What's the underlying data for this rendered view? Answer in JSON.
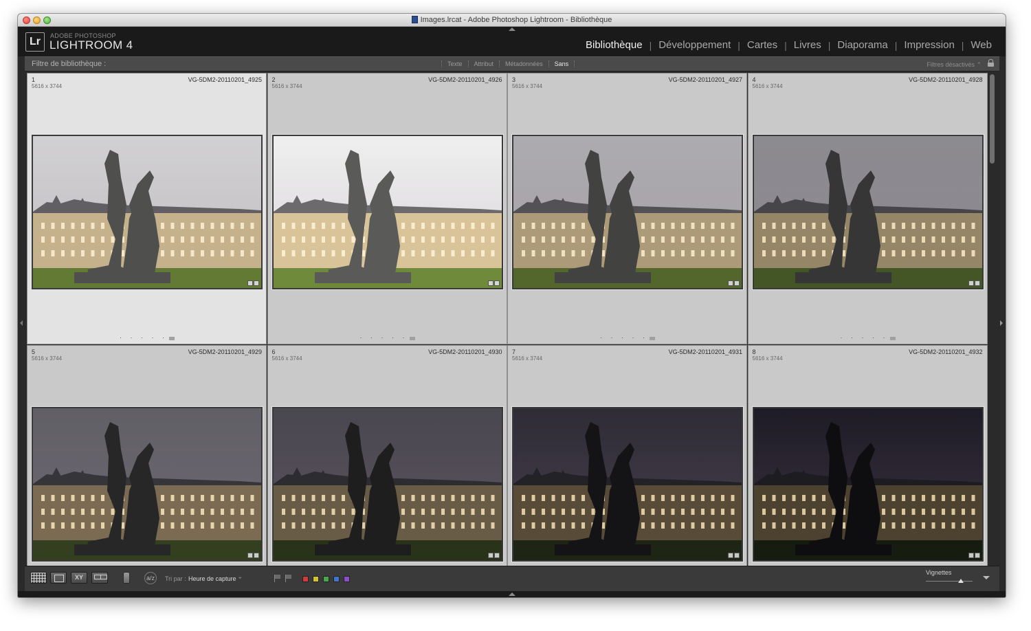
{
  "window": {
    "title": "Images.lrcat - Adobe Photoshop Lightroom - Bibliothèque"
  },
  "header": {
    "product": "ADOBE PHOTOSHOP",
    "version": "LIGHTROOM 4",
    "logo": "Lr",
    "modules": [
      {
        "label": "Bibliothèque",
        "active": true
      },
      {
        "label": "Développement",
        "active": false
      },
      {
        "label": "Cartes",
        "active": false
      },
      {
        "label": "Livres",
        "active": false
      },
      {
        "label": "Diaporama",
        "active": false
      },
      {
        "label": "Impression",
        "active": false
      },
      {
        "label": "Web",
        "active": false
      }
    ],
    "module_separator": "|"
  },
  "filter_bar": {
    "label": "Filtre de bibliothèque :",
    "tabs": [
      {
        "label": "Texte",
        "active": false
      },
      {
        "label": "Attribut",
        "active": false
      },
      {
        "label": "Métadonnées",
        "active": false
      },
      {
        "label": "Sans",
        "active": true
      }
    ],
    "status": "Filtres désactivés",
    "status_chevron": "⌃"
  },
  "grid": {
    "cells": [
      {
        "index": "1",
        "dims": "5616 x 3744",
        "filename": "VG-5DM2-20110201_4925",
        "exposure": 1.0,
        "rating_dots": "· · · · ·",
        "bg": "#e3e3e3"
      },
      {
        "index": "2",
        "dims": "5616 x 3744",
        "filename": "VG-5DM2-20110201_4926",
        "exposure": 1.15,
        "rating_dots": "· · · · ·",
        "bg": "#c9c9c9"
      },
      {
        "index": "3",
        "dims": "5616 x 3744",
        "filename": "VG-5DM2-20110201_4927",
        "exposure": 0.82,
        "rating_dots": "· · · · ·",
        "bg": "#c9c9c9"
      },
      {
        "index": "4",
        "dims": "5616 x 3744",
        "filename": "VG-5DM2-20110201_4928",
        "exposure": 0.66,
        "rating_dots": "· · · · ·",
        "bg": "#c9c9c9"
      },
      {
        "index": "5",
        "dims": "5616 x 3744",
        "filename": "VG-5DM2-20110201_4929",
        "exposure": 0.45,
        "rating_dots": "",
        "bg": "#c9c9c9"
      },
      {
        "index": "6",
        "dims": "5616 x 3744",
        "filename": "VG-5DM2-20110201_4930",
        "exposure": 0.33,
        "rating_dots": "",
        "bg": "#c9c9c9"
      },
      {
        "index": "7",
        "dims": "5616 x 3744",
        "filename": "VG-5DM2-20110201_4931",
        "exposure": 0.2,
        "rating_dots": "",
        "bg": "#c9c9c9"
      },
      {
        "index": "8",
        "dims": "5616 x 3744",
        "filename": "VG-5DM2-20110201_4932",
        "exposure": 0.12,
        "rating_dots": "",
        "bg": "#c9c9c9"
      }
    ]
  },
  "toolbar": {
    "compare_label": "XY",
    "sort_icon_label": "a/z",
    "sort_label": "Tri par :",
    "sort_value": "Heure de capture",
    "sort_chevron": "÷",
    "color_labels": [
      "#d23b3b",
      "#d4c22c",
      "#4aa84a",
      "#3f74c9",
      "#8a4fc7"
    ],
    "thumbnail_label": "Vignettes",
    "thumbnail_size": 0.75
  }
}
